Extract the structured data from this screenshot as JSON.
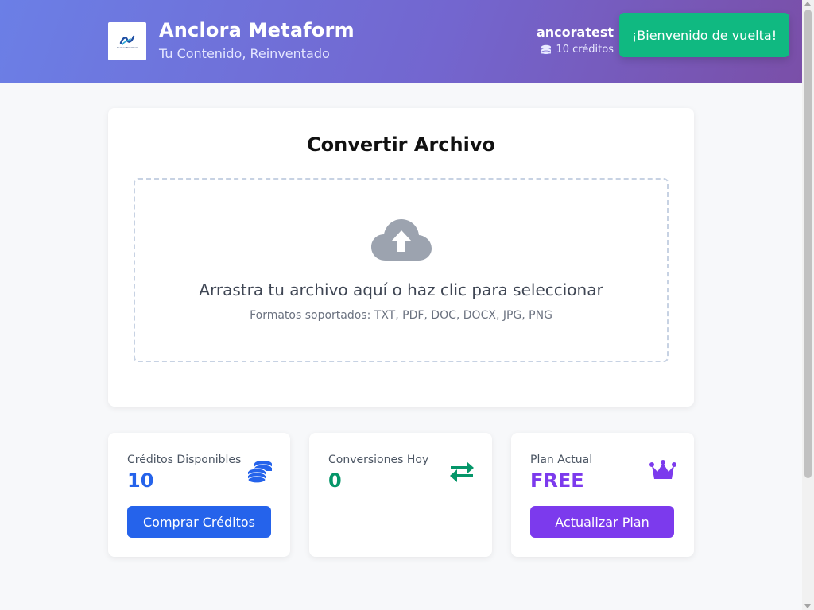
{
  "header": {
    "logo_caption": "Anclora Metaform",
    "title": "Anclora Metaform",
    "subtitle": "Tu Contenido, Reinventado",
    "username": "ancoratest",
    "credits_text": "10 créditos",
    "gradient_start": "#6b7fe6",
    "gradient_end": "#7a4fa8"
  },
  "toast": {
    "message": "¡Bienvenido de vuelta!",
    "color": "#10b981"
  },
  "converter": {
    "title": "Convertir Archivo",
    "icon": "cloud-upload-icon",
    "drop_text": "Arrastra tu archivo aquí o haz clic para seleccionar",
    "formats": "Formatos soportados: TXT, PDF, DOC, DOCX, JPG, PNG"
  },
  "stats": [
    {
      "label": "Créditos Disponibles",
      "value": "10",
      "icon": "coins-icon",
      "color": "#2563eb",
      "button": "Comprar Créditos"
    },
    {
      "label": "Conversiones Hoy",
      "value": "0",
      "icon": "exchange-arrows-icon",
      "color": "#059669"
    },
    {
      "label": "Plan Actual",
      "value": "FREE",
      "icon": "crown-icon",
      "color": "#7c3aed",
      "button": "Actualizar Plan"
    }
  ]
}
